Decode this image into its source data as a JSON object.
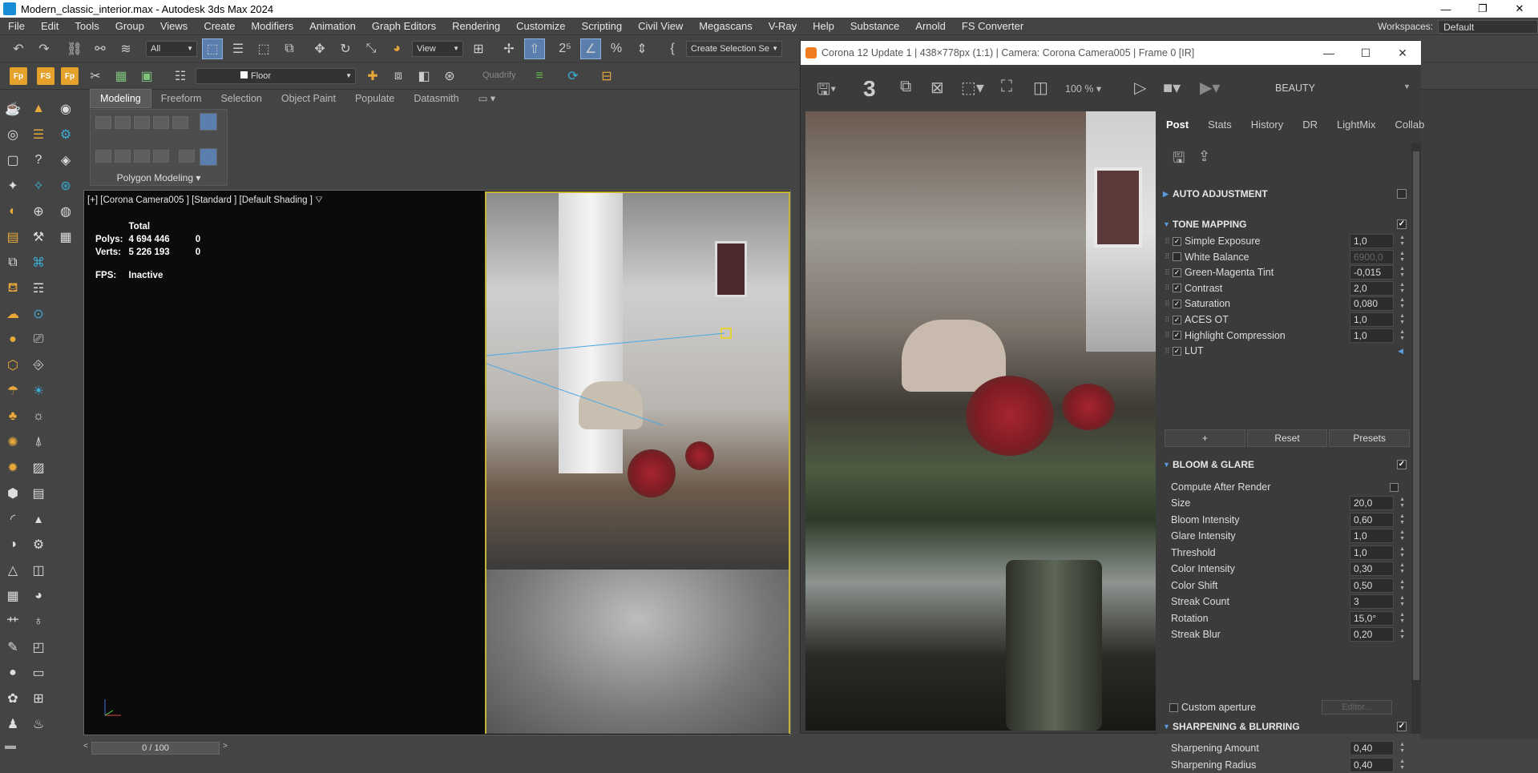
{
  "window": {
    "title": "Modern_classic_interior.max - Autodesk 3ds Max 2024",
    "minimize": "—",
    "maximize": "❐",
    "close": "✕"
  },
  "menu": [
    "File",
    "Edit",
    "Tools",
    "Group",
    "Views",
    "Create",
    "Modifiers",
    "Animation",
    "Graph Editors",
    "Rendering",
    "Customize",
    "Scripting",
    "Civil View",
    "Megascans",
    "V-Ray",
    "Help",
    "Substance",
    "Arnold",
    "FS Converter"
  ],
  "workspaces": {
    "label": "Workspaces:",
    "value": "Default"
  },
  "toolbar": {
    "selection_filter": "All",
    "ref_coord": "View",
    "named_selection": "Create Selection Se",
    "layer": "Floor",
    "quadrify": "Quadrify",
    "num3": "3"
  },
  "ribbon": {
    "tabs": [
      "Modeling",
      "Freeform",
      "Selection",
      "Object Paint",
      "Populate",
      "Datasmith"
    ],
    "panel_label": "Polygon Modeling"
  },
  "viewport": {
    "label": "[+] [Corona Camera005 ] [Standard ] [Default Shading ]",
    "stats": {
      "header": "Total",
      "polys_label": "Polys:",
      "polys_total": "4 694 446",
      "polys_sel": "0",
      "verts_label": "Verts:",
      "verts_total": "5 226 193",
      "verts_sel": "0",
      "fps_label": "FPS:",
      "fps_value": "Inactive"
    }
  },
  "timeline": {
    "frame": "0 / 100"
  },
  "corona": {
    "title": "Corona 12 Update 1 | 438×778px (1:1) | Camera: Corona Camera005 | Frame 0 [IR]",
    "zoom": "100 %",
    "pass": "BEAUTY",
    "tabs": [
      "Post",
      "Stats",
      "History",
      "DR",
      "LightMix",
      "Collab"
    ],
    "auto_adjustment": "AUTO ADJUSTMENT",
    "tone_mapping": {
      "title": "TONE MAPPING",
      "rows": [
        {
          "label": "Simple Exposure",
          "value": "1,0",
          "checked": true
        },
        {
          "label": "White Balance",
          "value": "6900,0",
          "checked": false
        },
        {
          "label": "Green-Magenta Tint",
          "value": "-0,015",
          "checked": true
        },
        {
          "label": "Contrast",
          "value": "2,0",
          "checked": true
        },
        {
          "label": "Saturation",
          "value": "0,080",
          "checked": true
        },
        {
          "label": "ACES OT",
          "value": "1,0",
          "checked": true
        },
        {
          "label": "Highlight Compression",
          "value": "1,0",
          "checked": true
        },
        {
          "label": "LUT",
          "value": "",
          "checked": true
        }
      ],
      "buttons": [
        "+",
        "Reset",
        "Presets"
      ]
    },
    "bloom": {
      "title": "BLOOM & GLARE",
      "compute_after": "Compute After Render",
      "rows": [
        {
          "label": "Size",
          "value": "20,0"
        },
        {
          "label": "Bloom Intensity",
          "value": "0,60"
        },
        {
          "label": "Glare Intensity",
          "value": "1,0"
        },
        {
          "label": "Threshold",
          "value": "1,0"
        },
        {
          "label": "Color Intensity",
          "value": "0,30"
        },
        {
          "label": "Color Shift",
          "value": "0,50"
        },
        {
          "label": "Streak Count",
          "value": "3"
        },
        {
          "label": "Rotation",
          "value": "15,0°"
        },
        {
          "label": "Streak Blur",
          "value": "0,20"
        }
      ],
      "custom_aperture": "Custom aperture",
      "editor": "Editor..."
    },
    "sharpening": {
      "title": "SHARPENING & BLURRING",
      "rows": [
        {
          "label": "Sharpening Amount",
          "value": "0,40"
        },
        {
          "label": "Sharpening Radius",
          "value": "0,40"
        }
      ]
    }
  }
}
